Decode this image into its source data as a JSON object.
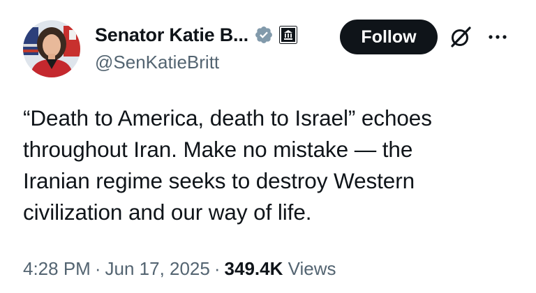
{
  "author": {
    "display_name": "Senator Katie B...",
    "handle": "@SenKatieBritt",
    "avatar_icon": "profile-photo",
    "verified_icon": "verified-badge-icon",
    "affiliation_icon": "government-building-icon"
  },
  "actions": {
    "follow_label": "Follow",
    "grok_icon": "grok-icon",
    "more_icon": "more-options-icon"
  },
  "tweet": {
    "lines": [
      "“Death to America, death to Israel” echoes",
      "throughout Iran. Make no mistake — the",
      "Iranian regime seeks to destroy Western",
      "civilization and our way of life."
    ]
  },
  "meta": {
    "time": "4:28 PM",
    "separator": "·",
    "date": "Jun 17, 2025",
    "views_count": "349.4K",
    "views_label": "Views"
  },
  "colors": {
    "text_primary": "#0f1419",
    "text_secondary": "#536471",
    "verified_badge": "#829aab",
    "button_bg": "#0f1419",
    "button_text": "#ffffff"
  }
}
